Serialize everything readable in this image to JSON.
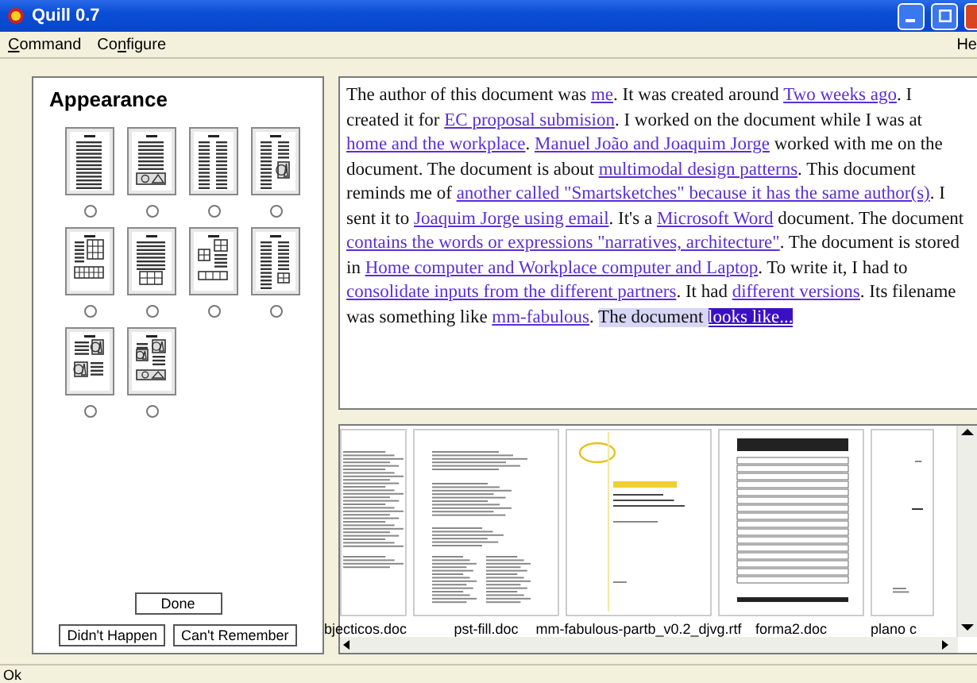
{
  "window": {
    "title": "Quill 0.7"
  },
  "menu": [
    {
      "mnemonic": "C",
      "rest": "ommand"
    },
    {
      "before": "Co",
      "mnemonic": "n",
      "rest": "figure"
    },
    {
      "label": "He"
    }
  ],
  "appearance": {
    "title": "Appearance",
    "layouts": [
      {
        "kind": "text",
        "selected": false
      },
      {
        "kind": "text-image",
        "selected": false
      },
      {
        "kind": "two-column",
        "selected": false
      },
      {
        "kind": "column-figure",
        "selected": false
      },
      {
        "kind": "grid-table",
        "selected": false
      },
      {
        "kind": "text-table",
        "selected": false
      },
      {
        "kind": "mixed-table",
        "selected": false
      },
      {
        "kind": "column-table",
        "selected": false
      },
      {
        "kind": "figure-text",
        "selected": false
      },
      {
        "kind": "image-mix",
        "selected": false
      }
    ],
    "buttons": [
      {
        "label": "Done"
      },
      {
        "label": "Didn't Happen"
      },
      {
        "label": "Can't Remember"
      }
    ]
  },
  "narrative": [
    {
      "text": "The author of this document was ",
      "kind": "text"
    },
    {
      "text": "me",
      "kind": "link"
    },
    {
      "text": ". It was created around ",
      "kind": "text"
    },
    {
      "text": "Two weeks ago",
      "kind": "link"
    },
    {
      "text": ". I created it for ",
      "kind": "text"
    },
    {
      "text": "EC proposal submision",
      "kind": "link"
    },
    {
      "text": ". I worked on the document while I was at ",
      "kind": "text"
    },
    {
      "text": "home and the workplace",
      "kind": "link"
    },
    {
      "text": ". ",
      "kind": "text"
    },
    {
      "text": "Manuel João and Joaquim Jorge",
      "kind": "link"
    },
    {
      "text": " worked with me on the document. The document is about ",
      "kind": "text"
    },
    {
      "text": "multimodal design patterns",
      "kind": "link"
    },
    {
      "text": ". This document reminds me of ",
      "kind": "text"
    },
    {
      "text": "another called \"Smartsketches\" because it has the same author(s)",
      "kind": "link"
    },
    {
      "text": ". I sent it to ",
      "kind": "text"
    },
    {
      "text": "Joaquim Jorge using email",
      "kind": "link"
    },
    {
      "text": ". It's a ",
      "kind": "text"
    },
    {
      "text": "Microsoft Word",
      "kind": "link"
    },
    {
      "text": " document. The document ",
      "kind": "text"
    },
    {
      "text": "contains the words or expressions \"narratives, architecture\"",
      "kind": "link"
    },
    {
      "text": ". The document is stored in ",
      "kind": "text"
    },
    {
      "text": "Home computer and Workplace computer and Laptop",
      "kind": "link"
    },
    {
      "text": ". To write it, I had to ",
      "kind": "text"
    },
    {
      "text": "consolidate inputs from the different partners",
      "kind": "link"
    },
    {
      "text": ". It had ",
      "kind": "text"
    },
    {
      "text": "different versions",
      "kind": "link"
    },
    {
      "text": ". Its filename was something like ",
      "kind": "text"
    },
    {
      "text": "mm-fabulous",
      "kind": "link"
    },
    {
      "text": ". ",
      "kind": "text"
    },
    {
      "text": "The document ",
      "kind": "highlight"
    },
    {
      "text": "looks like...",
      "kind": "selected-link"
    }
  ],
  "documents": [
    {
      "filename": "bjecticos.doc",
      "kind": "dense-text"
    },
    {
      "filename": "pst-fill.doc",
      "kind": "list"
    },
    {
      "filename": "mm-fabulous-partb_v0.2_djvg.rtf",
      "kind": "cover"
    },
    {
      "filename": "forma2.doc",
      "kind": "form"
    },
    {
      "filename": "plano c",
      "kind": "sparse"
    }
  ],
  "status_bar": {
    "text": "Ok"
  }
}
